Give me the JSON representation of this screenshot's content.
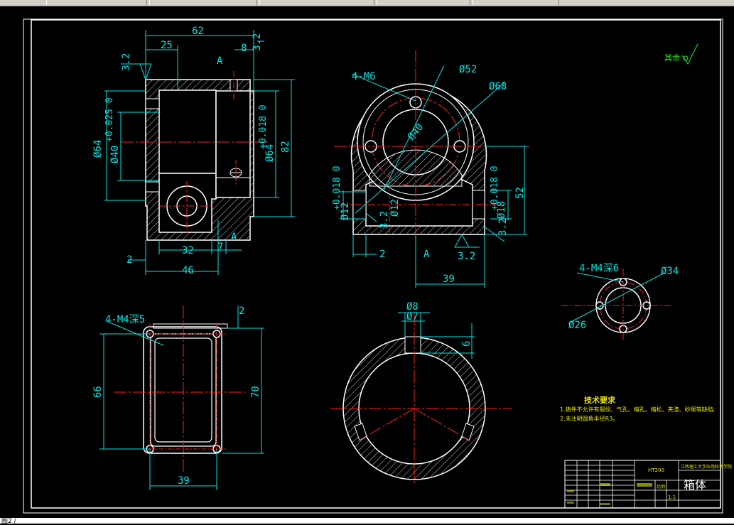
{
  "surface_note": "其余",
  "dimensions": {
    "top_width": "62",
    "top_25": "25",
    "top_8": "8",
    "roughness_3_2": "3.2",
    "section_A": "A",
    "dia64": "Ø64",
    "dia40": "Ø40",
    "tol40": "+0.025 0",
    "dia64b": "Ø64",
    "tol64b": "+0.018 0",
    "h82": "82",
    "d2": "2",
    "d32": "32",
    "d7": "7",
    "d46": "46",
    "m6": "4-M6",
    "dia52": "Ø52",
    "dia68": "Ø68",
    "dia40b": "Ø40",
    "dia12": "Ø12",
    "tol12": "+0.018 0",
    "dia12b": "Ø12",
    "dia18": "Ø18",
    "tol18": "+0.018 0",
    "h52": "52",
    "w39a": "39",
    "m4a": "4-M4深6",
    "dia34": "Ø34",
    "dia26": "Ø26",
    "m4b": "4-M4深5",
    "d66": "66",
    "d70": "70",
    "w39b": "39",
    "d2b": "2",
    "dia8": "Ø8",
    "dia7": "Ø7",
    "d6": "6"
  },
  "tech_requirements": {
    "heading": "技术要求",
    "line1": "1.铸件不允许有裂纹、气孔、缩孔、缩松、夹渣、砂眼等缺陷;",
    "line2": "2.未注明圆角半径R3。"
  },
  "title_block": {
    "part_name": "箱体",
    "school": "江西理工大学应用科学学院",
    "material": "HT200",
    "scale": "1:1",
    "scale_label": "比例"
  },
  "bottom_status": "图2 /"
}
